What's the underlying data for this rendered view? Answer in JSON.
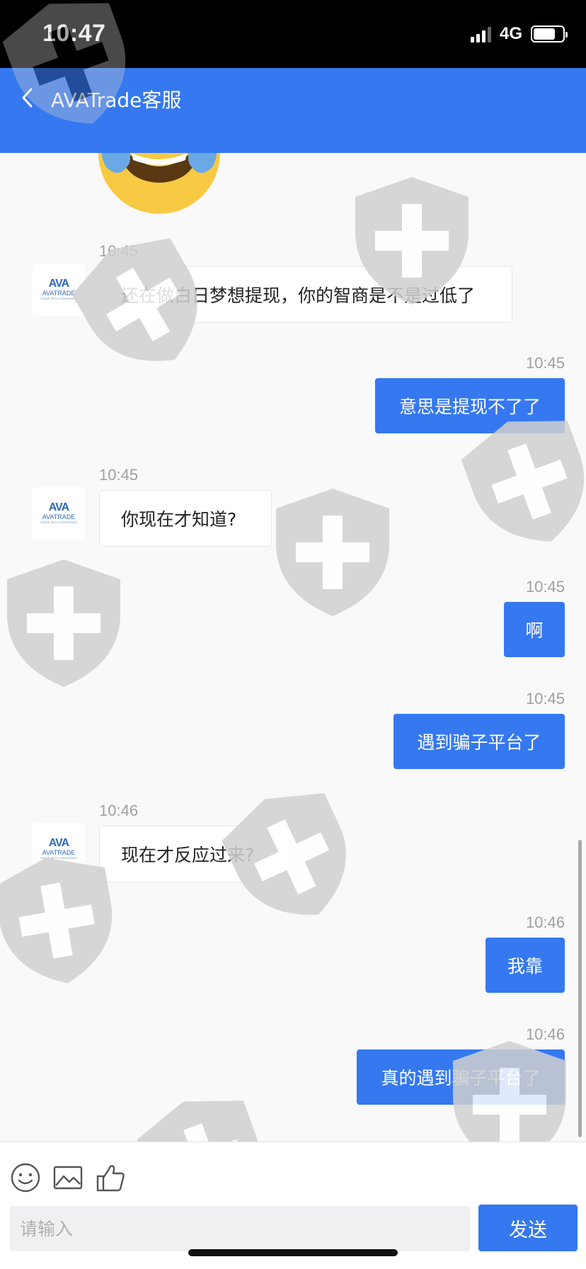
{
  "status_bar": {
    "time": "10:47",
    "network": "4G",
    "battery_level": 0.75
  },
  "header": {
    "back_icon": "chevron-left-icon",
    "title": "AVATrade客服"
  },
  "avatar_logo": {
    "mark": "AVA",
    "wordmark": "AVATRADE",
    "tagline": "TRADE WITH CONFIDENCE"
  },
  "messages": [
    {
      "side": "left",
      "time": "10:45",
      "text": "还在做白日梦想提现，你的智商是不是过低了"
    },
    {
      "side": "right",
      "time": "10:45",
      "text": "意思是提现不了了"
    },
    {
      "side": "left",
      "time": "10:45",
      "text": "你现在才知道?"
    },
    {
      "side": "right",
      "time": "10:45",
      "text": "啊"
    },
    {
      "side": "right",
      "time": "10:45",
      "text": "遇到骗子平台了"
    },
    {
      "side": "left",
      "time": "10:46",
      "text": "现在才反应过来?"
    },
    {
      "side": "right",
      "time": "10:46",
      "text": "我靠"
    },
    {
      "side": "right",
      "time": "10:46",
      "text": "真的遇到骗子平台了"
    }
  ],
  "toolbar": {
    "icons": [
      "emoji-icon",
      "image-icon",
      "thumbs-up-icon"
    ]
  },
  "composer": {
    "placeholder": "请输入",
    "send_label": "发送"
  },
  "colors": {
    "primary": "#3578f0",
    "status_bar": "#000000",
    "background": "#f9f9f9"
  }
}
